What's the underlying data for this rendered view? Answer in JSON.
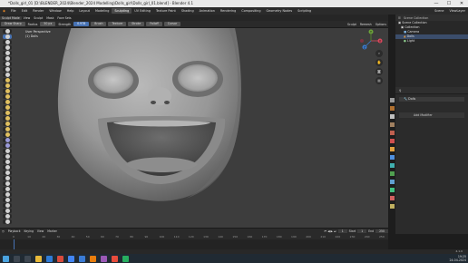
{
  "window": {
    "title": "*Dolls_girl_01 [D:\\BLENDER_2024\\Blender_2024 Modelling\\Dolls_girl\\Dolls_girl_01.blend] - Blender 4.1",
    "minimize": "—",
    "maximize": "☐",
    "close": "✕"
  },
  "menu": {
    "items": [
      "File",
      "Edit",
      "Render",
      "Window",
      "Help"
    ],
    "workspaces": [
      "Layout",
      "Modeling",
      "Sculpting",
      "UV Editing",
      "Texture Paint",
      "Shading",
      "Animation",
      "Rendering",
      "Compositing",
      "Geometry Nodes",
      "Scripting"
    ],
    "active_workspace": "Sculpting",
    "scene_label": "Scene",
    "viewlayer_label": "ViewLayer"
  },
  "mode": {
    "mode": "Sculpt Mode",
    "items": [
      "View",
      "Sculpt",
      "Mask",
      "Face Sets"
    ]
  },
  "tool_settings": {
    "brush": "Draw Sharp",
    "radius_label": "Radius",
    "radius": "50 px",
    "strength_label": "Strength",
    "strength": "0.978",
    "buttons": [
      "Brush",
      "Texture",
      "Stroke",
      "Falloff",
      "Cursor"
    ],
    "options": [
      "Sculpt",
      "Remesh",
      "Options"
    ]
  },
  "viewport": {
    "perspective": "User Perspective",
    "object": "(1) Dolls",
    "gizmo": {
      "x": "X",
      "y": "Y",
      "z": "Z"
    }
  },
  "tool_icons": [
    {
      "name": "draw-brush",
      "color": "#d2d2d2"
    },
    {
      "name": "draw-sharp-brush",
      "color": "#d2d2d2"
    },
    {
      "name": "clay-brush",
      "color": "#d2d2d2"
    },
    {
      "name": "clay-strips-brush",
      "color": "#d2d2d2"
    },
    {
      "name": "clay-thumb-brush",
      "color": "#d2d2d2"
    },
    {
      "name": "layer-brush",
      "color": "#d2d2d2"
    },
    {
      "name": "inflate-brush",
      "color": "#d2d2d2"
    },
    {
      "name": "blob-brush",
      "color": "#d2d2d2"
    },
    {
      "name": "crease-brush",
      "color": "#d2d2d2"
    },
    {
      "name": "smooth-brush",
      "color": "#e0c060"
    },
    {
      "name": "flatten-brush",
      "color": "#e0c060"
    },
    {
      "name": "fill-brush",
      "color": "#e0c060"
    },
    {
      "name": "scrape-brush",
      "color": "#e0c060"
    },
    {
      "name": "multiplane-scrape-brush",
      "color": "#e0c060"
    },
    {
      "name": "pinch-brush",
      "color": "#e0c060"
    },
    {
      "name": "grab-brush",
      "color": "#e0c060"
    },
    {
      "name": "elastic-deform-brush",
      "color": "#e0c060"
    },
    {
      "name": "snake-hook-brush",
      "color": "#e0c060"
    },
    {
      "name": "thumb-brush",
      "color": "#e0c060"
    },
    {
      "name": "pose-brush",
      "color": "#e0c060"
    },
    {
      "name": "nudge-brush",
      "color": "#9a9ad8"
    },
    {
      "name": "rotate-brush",
      "color": "#9a9ad8"
    },
    {
      "name": "slide-relax-brush",
      "color": "#d2d2d2"
    },
    {
      "name": "boundary-brush",
      "color": "#d2d2d2"
    },
    {
      "name": "cloth-brush",
      "color": "#d2d2d2"
    },
    {
      "name": "simplify-brush",
      "color": "#d2d2d2"
    },
    {
      "name": "mask-brush",
      "color": "#d2d2d2"
    },
    {
      "name": "draw-face-sets-brush",
      "color": "#d2d2d2"
    },
    {
      "name": "box-mask",
      "color": "#d2d2d2"
    },
    {
      "name": "lasso-mask",
      "color": "#d2d2d2"
    },
    {
      "name": "line-mask",
      "color": "#d2d2d2"
    },
    {
      "name": "box-trim",
      "color": "#d2d2d2"
    },
    {
      "name": "line-project",
      "color": "#d2d2d2"
    },
    {
      "name": "mesh-filter",
      "color": "#d2d2d2"
    },
    {
      "name": "cloth-filter",
      "color": "#d2d2d2"
    },
    {
      "name": "color-filter",
      "color": "#d2d2d2"
    }
  ],
  "outliner": {
    "search": "Scene Collection",
    "rows": [
      {
        "label": "Scene Collection",
        "selected": false
      },
      {
        "label": "Collection",
        "selected": false
      },
      {
        "label": "Camera",
        "selected": false
      },
      {
        "label": "Dolls",
        "selected": true
      },
      {
        "label": "Light",
        "selected": false
      }
    ]
  },
  "properties": {
    "object_name": "Dolls",
    "panel": "Add Modifier"
  },
  "timeline": {
    "menus": [
      "Playback",
      "Keying",
      "View",
      "Marker"
    ],
    "start_label": "Start",
    "start": "1",
    "end_label": "End",
    "end": "250",
    "current_frame": "1",
    "ticks": [
      "0",
      "10",
      "20",
      "30",
      "40",
      "50",
      "60",
      "70",
      "80",
      "90",
      "100",
      "110",
      "120",
      "130",
      "140",
      "150",
      "160",
      "170",
      "180",
      "190",
      "200",
      "210",
      "220",
      "230",
      "240",
      "250"
    ]
  },
  "status": {
    "version": "4.1.0"
  },
  "clock": {
    "time": "19:25",
    "date": "24-04-2024"
  },
  "colors": {
    "accent": "#4772b3",
    "viewport_bg": "#3d3d3d",
    "selected_row": "#3b4d6b"
  }
}
